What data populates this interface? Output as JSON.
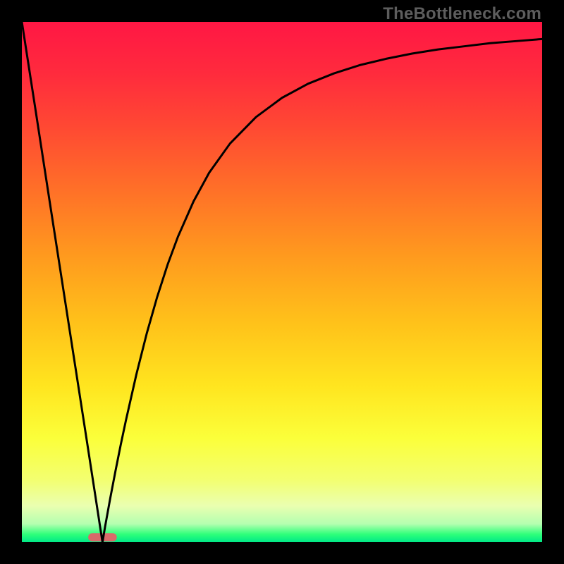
{
  "watermark": "TheBottleneck.com",
  "chart_data": {
    "type": "line",
    "title": "",
    "xlabel": "",
    "ylabel": "",
    "xlim": [
      0,
      100
    ],
    "ylim": [
      0,
      100
    ],
    "grid": false,
    "legend": false,
    "min_marker_x": 15.5,
    "curve_points": [
      {
        "x": 0.0,
        "y": 100.0
      },
      {
        "x": 2.5,
        "y": 83.9
      },
      {
        "x": 5.0,
        "y": 67.7
      },
      {
        "x": 7.5,
        "y": 51.6
      },
      {
        "x": 10.0,
        "y": 35.5
      },
      {
        "x": 12.5,
        "y": 19.4
      },
      {
        "x": 14.0,
        "y": 9.7
      },
      {
        "x": 15.0,
        "y": 3.2
      },
      {
        "x": 15.5,
        "y": 0.0
      },
      {
        "x": 16.0,
        "y": 3.0
      },
      {
        "x": 17.0,
        "y": 8.5
      },
      {
        "x": 18.0,
        "y": 13.7
      },
      {
        "x": 19.0,
        "y": 18.7
      },
      {
        "x": 20.0,
        "y": 23.4
      },
      {
        "x": 22.0,
        "y": 32.2
      },
      {
        "x": 24.0,
        "y": 40.1
      },
      {
        "x": 26.0,
        "y": 47.1
      },
      {
        "x": 28.0,
        "y": 53.3
      },
      {
        "x": 30.0,
        "y": 58.7
      },
      {
        "x": 33.0,
        "y": 65.5
      },
      {
        "x": 36.0,
        "y": 71.0
      },
      {
        "x": 40.0,
        "y": 76.6
      },
      {
        "x": 45.0,
        "y": 81.7
      },
      {
        "x": 50.0,
        "y": 85.4
      },
      {
        "x": 55.0,
        "y": 88.1
      },
      {
        "x": 60.0,
        "y": 90.1
      },
      {
        "x": 65.0,
        "y": 91.7
      },
      {
        "x": 70.0,
        "y": 92.9
      },
      {
        "x": 75.0,
        "y": 93.9
      },
      {
        "x": 80.0,
        "y": 94.7
      },
      {
        "x": 85.0,
        "y": 95.3
      },
      {
        "x": 90.0,
        "y": 95.9
      },
      {
        "x": 95.0,
        "y": 96.3
      },
      {
        "x": 100.0,
        "y": 96.7
      }
    ],
    "gradient_stops": [
      {
        "offset": 0.0,
        "color": "#ff1744"
      },
      {
        "offset": 0.1,
        "color": "#ff2b3d"
      },
      {
        "offset": 0.2,
        "color": "#ff4833"
      },
      {
        "offset": 0.32,
        "color": "#ff6f28"
      },
      {
        "offset": 0.45,
        "color": "#ff9a1e"
      },
      {
        "offset": 0.58,
        "color": "#ffc21a"
      },
      {
        "offset": 0.7,
        "color": "#ffe51f"
      },
      {
        "offset": 0.8,
        "color": "#fbff3a"
      },
      {
        "offset": 0.88,
        "color": "#f3ff70"
      },
      {
        "offset": 0.93,
        "color": "#eaffb0"
      },
      {
        "offset": 0.965,
        "color": "#b4ffb0"
      },
      {
        "offset": 0.985,
        "color": "#2eff7a"
      },
      {
        "offset": 1.0,
        "color": "#00e887"
      }
    ],
    "min_marker": {
      "fill": "#d96a6a",
      "width_frac": 0.055,
      "height_frac": 0.016
    }
  }
}
